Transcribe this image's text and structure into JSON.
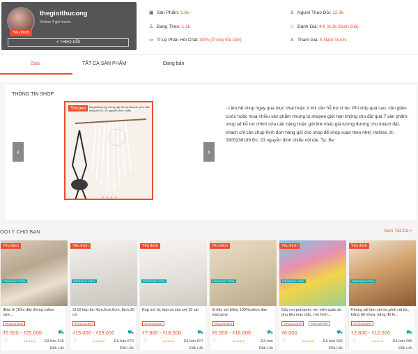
{
  "shop": {
    "name": "thegioithucong",
    "online": "Online 4 giờ trước",
    "badge": "Yêu thích",
    "follow_label": "+ THEO DÕI"
  },
  "stats": {
    "products_label": "Sản Phẩm:",
    "products_value": "1.6k",
    "following_label": "Đang Theo:",
    "following_value": "1.1k",
    "response_label": "Tỉ Lệ Phản Hồi Chat:",
    "response_value": "80% (Trong Vài Giờ)",
    "followers_label": "Người Theo Dõi:",
    "followers_value": "12.3k",
    "rating_label": "Đánh Giá:",
    "rating_value": "4.8 (6.3k Đánh Giá)",
    "joined_label": "Tham Gia:",
    "joined_value": "5 Năm Trước"
  },
  "tabs": [
    "Dạo",
    "TẤT CẢ SẢN PHẨM",
    "Đang bán"
  ],
  "info": {
    "title": "THÔNG TIN SHOP",
    "banner_brand": "Shopee",
    "banner_text": "thegioithucong Cung cấp đồ handmade, phụ kiện trang trí Đc: 23 nguyễn đình chiểu",
    "description": "- Liên hệ shop ngay qua mục chat hoặc zl khi cần hỗ trợ ví dụ: Phí ship quá cao, cần giảm cước hoặc mua nhiều sản phẩm nhưng bị shopee giới hạn không cho đặt quá 7 sản phẩm: shop sẽ hỗ trợ chỉnh sửa cân nặng hoặc gửi link khác giá tương đương cho khách đặt. khách chỉ cần chụp hình đơn hàng gửi cho shop để shop soạn theo nhé) Hotline, zl: 0905336199 Đc: 23 nguyễn đình chiểu nối dài. Tp. Be"
  },
  "recommend": {
    "title": "GỢI Ý CHO BẠN",
    "see_all": "Xem Tất Cả >"
  },
  "products": [
    {
      "name": "(Bán lẻ )10m dây thừng cotton size...",
      "tag": "ShopDacBiet",
      "tag2": "",
      "price": "₫6.500 - ₫25.000",
      "sold": "Đã bán 526",
      "loc": "Đắk Lắk"
    },
    {
      "name": "Sỉ 10 kẹp tóc 4cm,5cm,6cm, 8cm,10 cm",
      "tag": "ShopDacBiet",
      "tag2": "",
      "price": "₫15.000 - ₫29.000",
      "sold": "Đã bán 874",
      "loc": "Đắk Lắk"
    },
    {
      "name": "Kẹp mỏ vịt, kẹp cá sấu set 10 cái",
      "tag": "ShopDacBiet",
      "tag2": "",
      "price": "₫7.900 - ₫18.000",
      "sold": "Đã bán 827",
      "loc": "Đắk Lắk"
    },
    {
      "name": "Sỉ dây sợi bông 100%cotton đan macrame",
      "tag": "ShopDacBiet",
      "tag2": "",
      "price": "₫6.500 - ₫18.000",
      "sold": "Đã bán",
      "loc": "Đắk Lắk"
    },
    {
      "name": "Dây ren pompom, ren viền quần áo phụ liệu may mặc, ren hình...",
      "tag": "ShopDacBiet",
      "tag2": "Mua giá tiền",
      "price": "₫6.000",
      "sold": "Đã bán 986",
      "loc": "Đắk Lắk"
    },
    {
      "name": "Khung sắt làm cài tóc,phối cài tóc, băng đô nhựa, băng đô ki...",
      "tag": "ShopDacBiet",
      "tag2": "",
      "price": "₫2.800 - ₫12.000",
      "sold": "Đã bán 986",
      "loc": "Đắk Lắk"
    }
  ],
  "card_badge": "Yêu thích",
  "freeship": "FREESHIP XTRA"
}
